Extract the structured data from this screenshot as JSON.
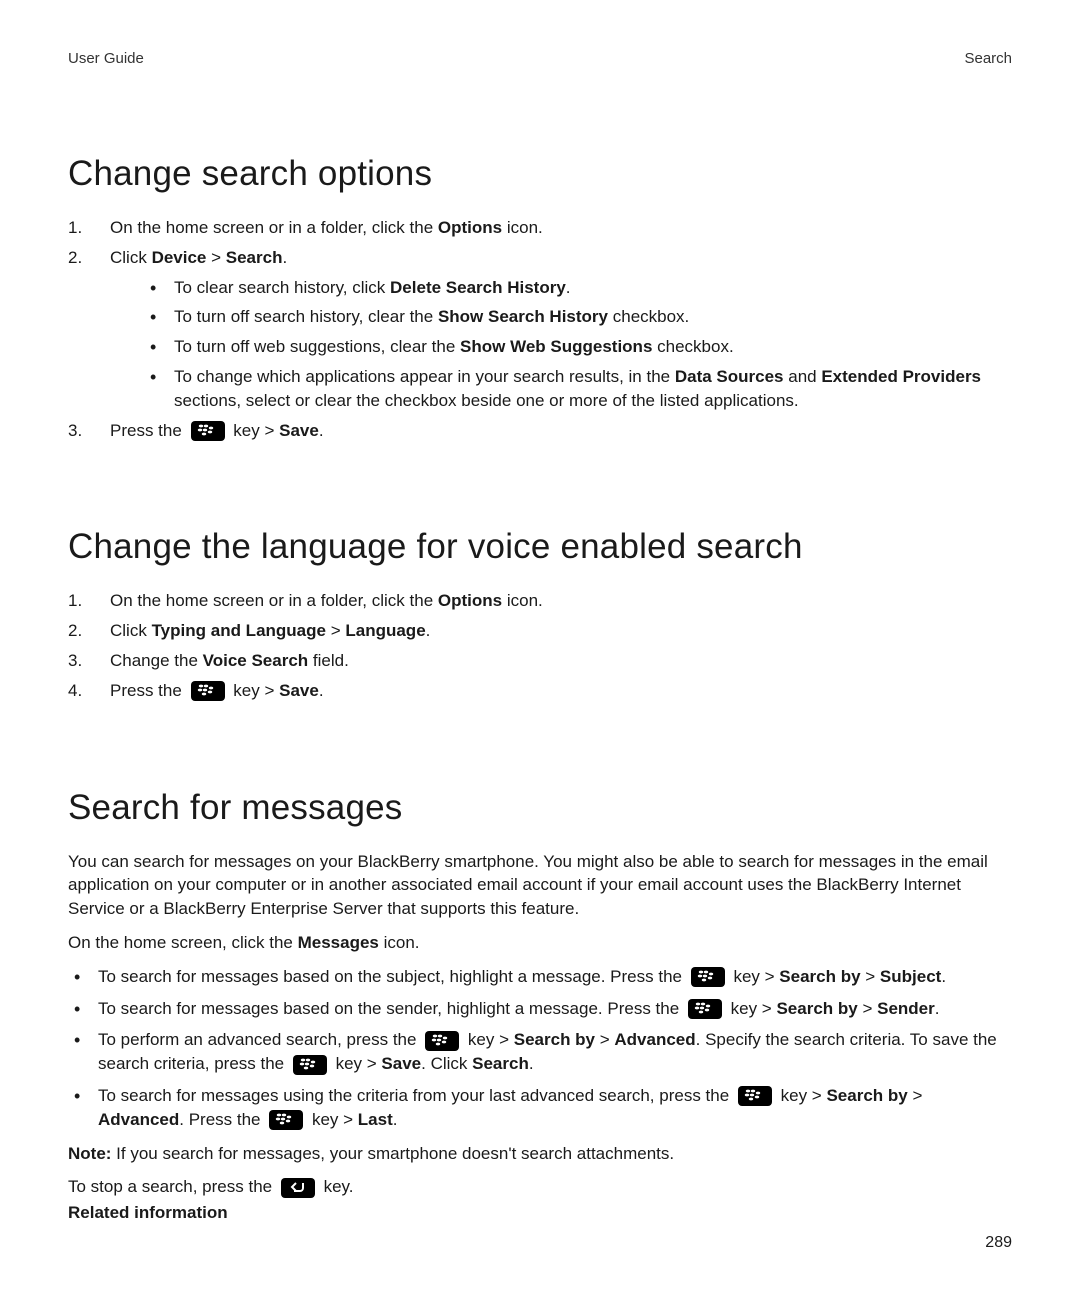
{
  "header": {
    "left": "User Guide",
    "right": "Search"
  },
  "page_number": "289",
  "section1": {
    "title": "Change search options",
    "step1_pre": "On the home screen or in a folder, click the ",
    "step1_b": "Options",
    "step1_post": " icon.",
    "step2_pre": "Click ",
    "step2_b1": "Device",
    "step2_gt": " > ",
    "step2_b2": "Search",
    "step2_post": ".",
    "b1_pre": "To clear search history, click ",
    "b1_b": "Delete Search History",
    "b1_post": ".",
    "b2_pre": "To turn off search history, clear the ",
    "b2_b": "Show Search History",
    "b2_post": " checkbox.",
    "b3_pre": "To turn off web suggestions, clear the ",
    "b3_b": "Show Web Suggestions",
    "b3_post": " checkbox.",
    "b4_pre": "To change which applications appear in your search results, in the ",
    "b4_b1": "Data Sources",
    "b4_mid": " and ",
    "b4_b2": "Extended Providers",
    "b4_post": " sections, select or clear the checkbox beside one or more of the listed applications.",
    "step3_pre": "Press the ",
    "step3_mid": " key > ",
    "step3_b": "Save",
    "step3_post": "."
  },
  "section2": {
    "title": "Change the language for voice enabled search",
    "s1_pre": "On the home screen or in a folder, click the ",
    "s1_b": "Options",
    "s1_post": " icon.",
    "s2_pre": "Click ",
    "s2_b1": "Typing and Language",
    "s2_gt": " > ",
    "s2_b2": "Language",
    "s2_post": ".",
    "s3_pre": "Change the ",
    "s3_b": "Voice Search",
    "s3_post": " field.",
    "s4_pre": "Press the ",
    "s4_mid": " key > ",
    "s4_b": "Save",
    "s4_post": "."
  },
  "section3": {
    "title": "Search for messages",
    "intro": "You can search for messages on your BlackBerry smartphone. You might also be able to search for messages in the email application on your computer or in another associated email account if your email account uses the BlackBerry Internet Service or a BlackBerry Enterprise Server that supports this feature.",
    "p2_pre": "On the home screen, click the ",
    "p2_b": "Messages",
    "p2_post": " icon.",
    "m1_pre": "To search for messages based on the subject, highlight a message. Press the ",
    "m1_mid": " key > ",
    "m1_b1": "Search by",
    "m1_gt": " > ",
    "m1_b2": "Subject",
    "m1_post": ".",
    "m2_pre": "To search for messages based on the sender, highlight a message. Press the ",
    "m2_mid": " key > ",
    "m2_b1": "Search by",
    "m2_gt": " > ",
    "m2_b2": "Sender",
    "m2_post": ".",
    "m3_pre": "To perform an advanced search, press the ",
    "m3_mid1": " key > ",
    "m3_b1": "Search by",
    "m3_gt1": " > ",
    "m3_b2": "Advanced",
    "m3_mid2": ". Specify the search criteria. To save the search criteria, press the ",
    "m3_mid3": " key > ",
    "m3_b3": "Save",
    "m3_mid4": ". Click ",
    "m3_b4": "Search",
    "m3_post": ".",
    "m4_pre": "To search for messages using the criteria from your last advanced search, press the ",
    "m4_mid1": " key > ",
    "m4_b1": "Search by",
    "m4_gt": " > ",
    "m4_b2": "Advanced",
    "m4_mid2": ". Press the ",
    "m4_mid3": " key > ",
    "m4_b3": "Last",
    "m4_post": ".",
    "note_b": "Note:",
    "note_post": " If you search for messages, your smartphone doesn't search attachments.",
    "stop_pre": "To stop a search, press the ",
    "stop_post": " key.",
    "related": "Related information"
  }
}
